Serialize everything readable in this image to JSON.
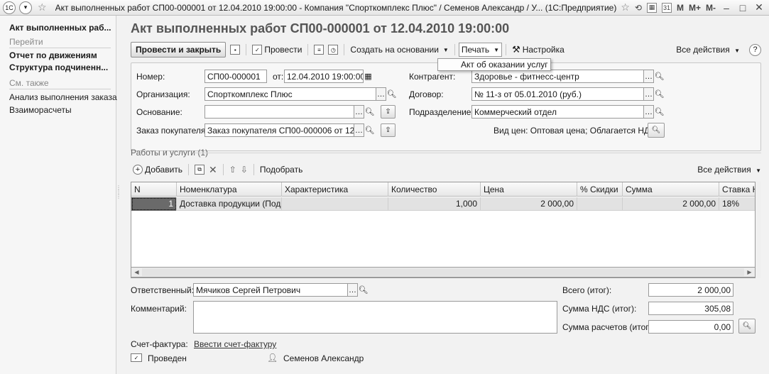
{
  "window": {
    "title": "Акт выполненных работ СП00-000001 от 12.04.2010 19:00:00 - Компания \"Спорткомплекс Плюс\" / Семенов Александр / У... (1С:Предприятие)",
    "app_badge": "1С",
    "m_label": "M",
    "mplus_label": "M+",
    "mminus_label": "M-"
  },
  "nav": {
    "current": "Акт выполненных раб...",
    "goto_header": "Перейти",
    "goto_items": [
      "Отчет по движениям",
      "Структура подчиненн..."
    ],
    "see_also_header": "См. также",
    "see_also_items": [
      "Анализ выполнения заказа",
      "Взаиморасчеты"
    ]
  },
  "doc": {
    "title": "Акт выполненных работ СП00-000001 от 12.04.2010 19:00:00"
  },
  "toolbar": {
    "post_close": "Провести и закрыть",
    "post": "Провести",
    "create_based": "Создать на основании",
    "print": "Печать",
    "settings": "Настройка",
    "all_actions": "Все действия",
    "help": "?"
  },
  "print_menu": {
    "items": [
      "Акт об оказании услуг"
    ]
  },
  "header": {
    "number_label": "Номер:",
    "number": "СП00-000001",
    "date_label": "от:",
    "date": "12.04.2010 19:00:00",
    "org_label": "Организация:",
    "org": "Спорткомплекс Плюс",
    "basis_label": "Основание:",
    "basis": "",
    "order_label": "Заказ покупателя:",
    "order": "Заказ покупателя СП00-000006 от 12.04...",
    "counterparty_label": "Контрагент:",
    "counterparty": "Здоровье - фитнесс-центр",
    "contract_label": "Договор:",
    "contract": "№ 11-з от 05.01.2010 (руб.)",
    "division_label": "Подразделение:",
    "division": "Коммерческий отдел",
    "price_type": "Вид цен: Оптовая цена; Облагается НДС"
  },
  "works": {
    "section_title": "Работы и услуги (1)",
    "add": "Добавить",
    "pick": "Подобрать",
    "all_actions": "Все действия",
    "columns": [
      "N",
      "Номенклатура",
      "Характеристика",
      "Количество",
      "Цена",
      "% Скидки",
      "Сумма",
      "Ставка НДС"
    ],
    "rows": [
      [
        "1",
        "Доставка продукции (Под...",
        "",
        "1,000",
        "2 000,00",
        "",
        "2 000,00",
        "18%"
      ]
    ]
  },
  "footer": {
    "responsible_label": "Ответственный:",
    "responsible": "Мячиков Сергей Петрович",
    "comment_label": "Комментарий:",
    "comment": "",
    "invoice_label": "Счет-фактура:",
    "invoice_link": "Ввести счет-фактуру",
    "total_label": "Всего (итог):",
    "total": "2 000,00",
    "vat_label": "Сумма НДС (итог):",
    "vat": "305,08",
    "settle_label": "Сумма расчетов (итог):",
    "settle": "0,00",
    "status": "Проведен",
    "author": "Семенов Александр"
  }
}
